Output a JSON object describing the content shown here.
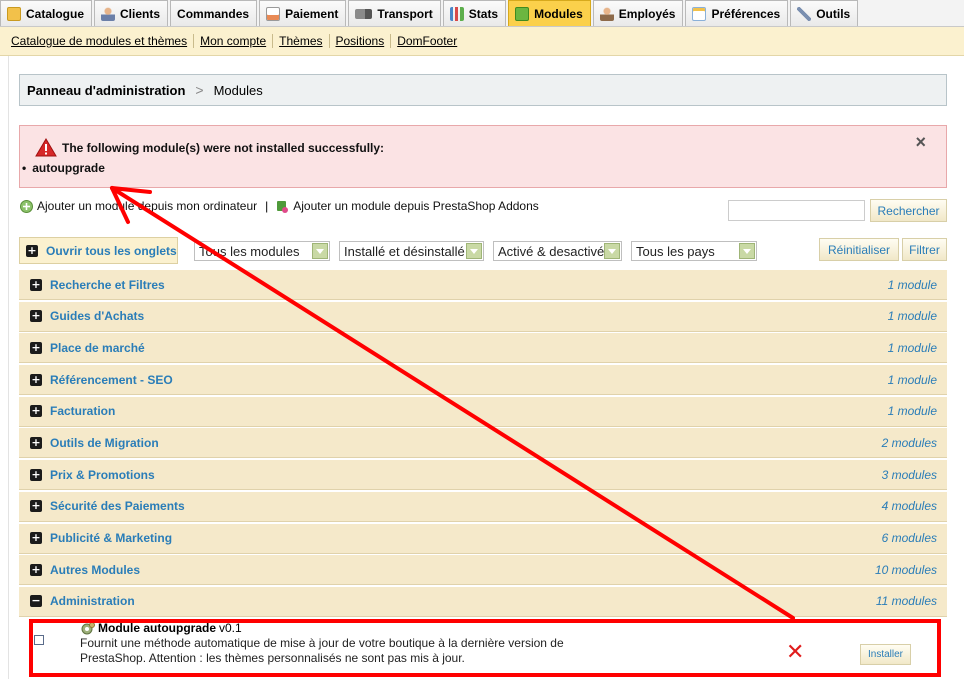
{
  "tabs": [
    {
      "label": "Catalogue",
      "icon": "folder-icon",
      "color": "#f2c14a"
    },
    {
      "label": "Clients",
      "icon": "user-icon",
      "color": "#c98a5c"
    },
    {
      "label": "Commandes",
      "icon": "",
      "color": ""
    },
    {
      "label": "Paiement",
      "icon": "payment-icon",
      "color": "#e98a55"
    },
    {
      "label": "Transport",
      "icon": "truck-icon",
      "color": "#8a8a8a"
    },
    {
      "label": "Stats",
      "icon": "chart-icon",
      "color": "#4a86c8"
    },
    {
      "label": "Modules",
      "icon": "puzzle-icon",
      "color": "#6cb640",
      "active": true
    },
    {
      "label": "Employés",
      "icon": "employee-icon",
      "color": "#8d6a4a"
    },
    {
      "label": "Préférences",
      "icon": "preferences-icon",
      "color": "#8ab0d8"
    },
    {
      "label": "Outils",
      "icon": "wrench-icon",
      "color": "#7a8fb0"
    }
  ],
  "subnav": [
    "Catalogue de modules et thèmes",
    "Mon compte",
    "Thèmes",
    "Positions",
    "DomFooter"
  ],
  "breadcrumb": {
    "title": "Panneau d'administration",
    "separator": ">",
    "current": "Modules"
  },
  "alert": {
    "message": "The following module(s) were not installed successfully:",
    "item": "autoupgrade",
    "close": "×"
  },
  "add_links": {
    "computer": "Ajouter un module depuis mon ordinateur",
    "separator": "|",
    "addons": "Ajouter un module depuis PrestaShop Addons"
  },
  "search": {
    "value": "",
    "button": "Rechercher"
  },
  "filters": {
    "open_all": "Ouvrir tous les onglets",
    "modules_select": "Tous les modules",
    "install_select": "Installé et désinstallé",
    "active_select": "Activé & desactivé",
    "country_select": "Tous les pays",
    "reset": "Réinitialiser",
    "filter": "Filtrer"
  },
  "categories": [
    {
      "name": "Recherche et Filtres",
      "count": "1 module",
      "expanded": false
    },
    {
      "name": "Guides d'Achats",
      "count": "1 module",
      "expanded": false
    },
    {
      "name": "Place de marché",
      "count": "1 module",
      "expanded": false
    },
    {
      "name": "Référencement - SEO",
      "count": "1 module",
      "expanded": false
    },
    {
      "name": "Facturation",
      "count": "1 module",
      "expanded": false
    },
    {
      "name": "Outils de Migration",
      "count": "2 modules",
      "expanded": false
    },
    {
      "name": "Prix & Promotions",
      "count": "3 modules",
      "expanded": false
    },
    {
      "name": "Sécurité des Paiements",
      "count": "4 modules",
      "expanded": false
    },
    {
      "name": "Publicité & Marketing",
      "count": "6 modules",
      "expanded": false
    },
    {
      "name": "Autres Modules",
      "count": "10 modules",
      "expanded": false
    },
    {
      "name": "Administration",
      "count": "11 modules",
      "expanded": true
    }
  ],
  "module": {
    "name": "Module autoupgrade",
    "version": "v0.1",
    "description_line1": "Fournit une méthode automatique de mise à jour de votre boutique à la dernière version de",
    "description_line2": "PrestaShop. Attention : les thèmes personnalisés ne sont pas mis à jour.",
    "status_icon": "x-mark-icon",
    "install_button": "Installer"
  },
  "colors": {
    "active_tab": "#fbd04b",
    "link_blue": "#2a7db8",
    "category_bg": "#f5e9ca",
    "alert_bg": "#fbe3e4",
    "annotation_red": "#ff0000"
  }
}
